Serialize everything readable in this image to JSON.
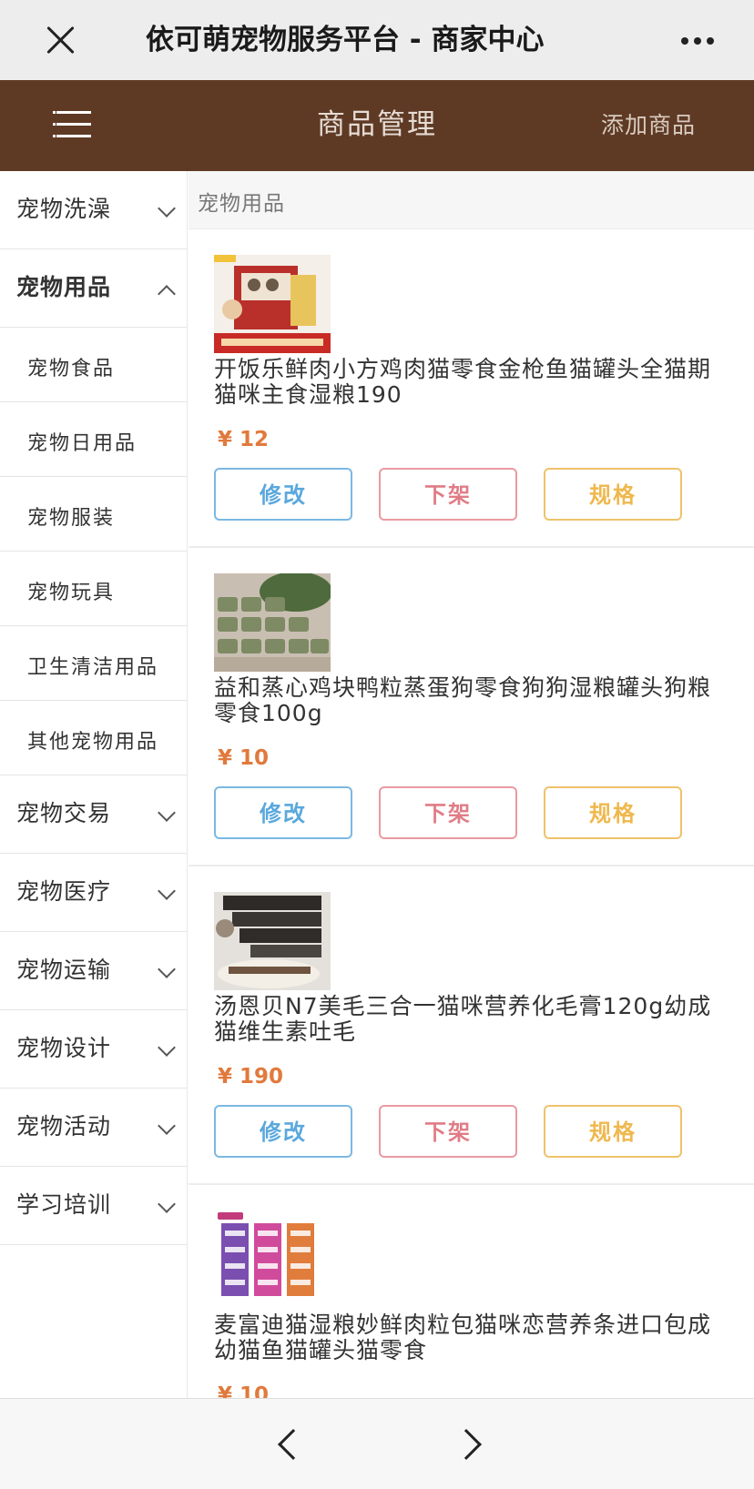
{
  "topbar": {
    "close_icon": "close-icon",
    "title": "依可萌宠物服务平台 - 商家中心",
    "more_icon": "more-dots-icon"
  },
  "header": {
    "menu_icon": "hamburger-icon",
    "title": "商品管理",
    "add_label": "添加商品",
    "bg_color": "#5e3a25"
  },
  "sidebar": {
    "categories": [
      {
        "label": "宠物洗澡",
        "expanded": false
      },
      {
        "label": "宠物用品",
        "expanded": true,
        "children": [
          "宠物食品",
          "宠物日用品",
          "宠物服装",
          "宠物玩具",
          "卫生清洁用品",
          "其他宠物用品"
        ]
      },
      {
        "label": "宠物交易",
        "expanded": false
      },
      {
        "label": "宠物医疗",
        "expanded": false
      },
      {
        "label": "宠物运输",
        "expanded": false
      },
      {
        "label": "宠物设计",
        "expanded": false
      },
      {
        "label": "宠物活动",
        "expanded": false
      },
      {
        "label": "学习培训",
        "expanded": false
      }
    ]
  },
  "main": {
    "section_title": "宠物用品",
    "buttons": {
      "edit": "修改",
      "off_shelf": "下架",
      "spec": "规格"
    },
    "products": [
      {
        "name": "开饭乐鲜肉小方鸡肉猫零食金枪鱼猫罐头全猫期猫咪主食湿粮190",
        "price": "¥ 12"
      },
      {
        "name": "益和蒸心鸡块鸭粒蒸蛋狗零食狗狗湿粮罐头狗粮零食100g",
        "price": "¥ 10"
      },
      {
        "name": "汤恩贝N7美毛三合一猫咪营养化毛膏120g幼成猫维生素吐毛",
        "price": "¥ 190"
      },
      {
        "name": "麦富迪猫湿粮妙鲜肉粒包猫咪恋营养条进口包成幼猫鱼猫罐头猫零食",
        "price": "¥ 10"
      }
    ]
  },
  "bottom": {
    "prev_icon": "chevron-left-icon",
    "next_icon": "chevron-right-icon"
  }
}
